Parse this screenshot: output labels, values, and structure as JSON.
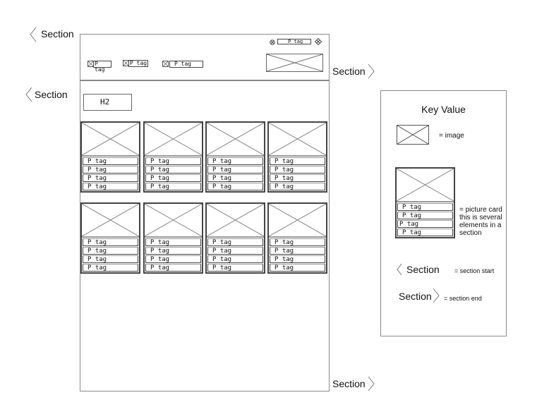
{
  "sections": {
    "label": "Section"
  },
  "header": {
    "tags": [
      {
        "label": "P tag"
      },
      {
        "label": "P tag"
      },
      {
        "label": "P tag"
      }
    ],
    "top_right_tag": "P tag"
  },
  "main": {
    "heading": "H2",
    "cards": [
      {
        "tags": [
          "P tag",
          "P tag",
          "P tag",
          "P tag"
        ]
      },
      {
        "tags": [
          "P tag",
          "P tag",
          "P tag",
          "P tag"
        ]
      },
      {
        "tags": [
          "P tag",
          "P tag",
          "P tag",
          "P tag"
        ]
      },
      {
        "tags": [
          "P tag",
          "P tag",
          "P tag",
          "P tag"
        ]
      },
      {
        "tags": [
          "P tag",
          "P tag",
          "P tag",
          "P tag"
        ]
      },
      {
        "tags": [
          "P tag",
          "P tag",
          "P tag",
          "P tag"
        ]
      },
      {
        "tags": [
          "P tag",
          "P tag",
          "P tag",
          "P tag"
        ]
      },
      {
        "tags": [
          "P tag",
          "P tag",
          "P tag",
          "P tag"
        ]
      }
    ]
  },
  "legend": {
    "title": "Key Value",
    "image_desc": "= image",
    "card_tags": [
      "P tag",
      "P tag",
      "P tag",
      "P tag"
    ],
    "card_desc": "= picture card this is several elements in a section",
    "section_start_label": "Section",
    "section_start_desc": "= section start",
    "section_end_label": "Section",
    "section_end_desc": "= section end"
  }
}
